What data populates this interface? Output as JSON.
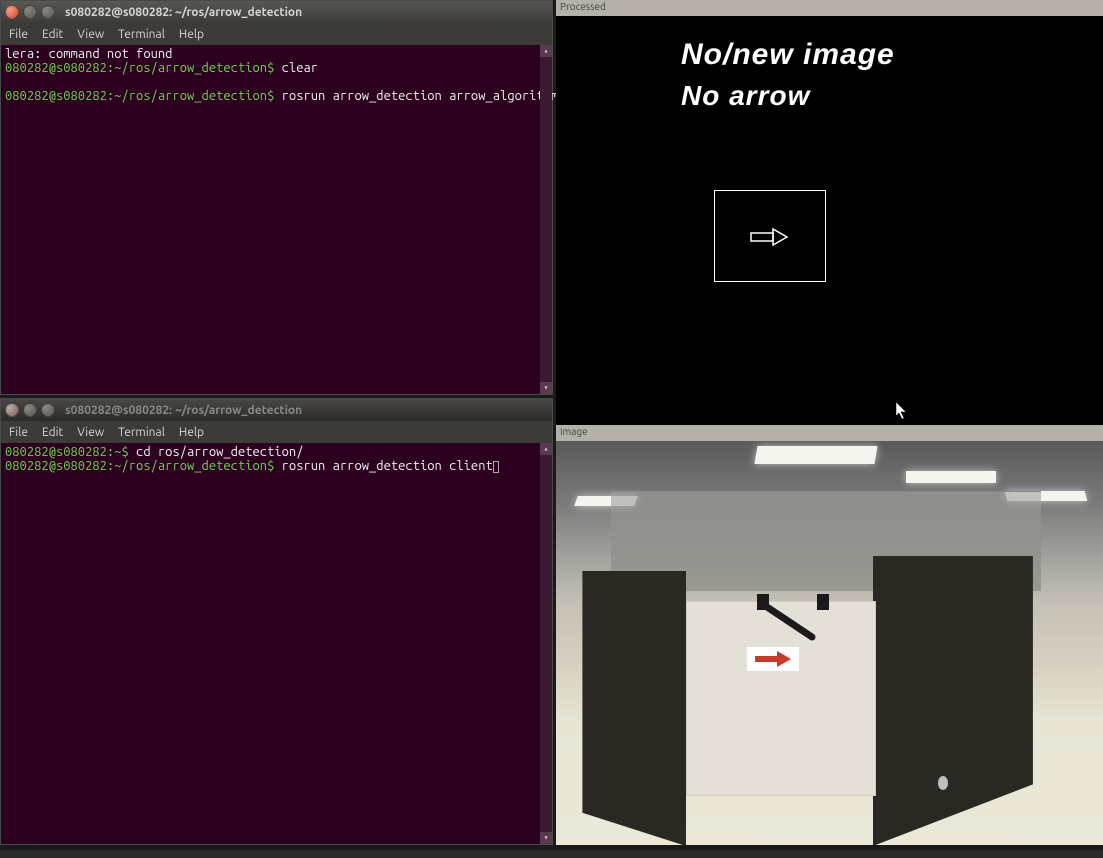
{
  "terminal1": {
    "title": "s080282@s080282: ~/ros/arrow_detection",
    "menu": [
      "File",
      "Edit",
      "View",
      "Terminal",
      "Help"
    ],
    "lines": [
      {
        "type": "output",
        "text": "lera: command not found"
      },
      {
        "type": "prompt",
        "prompt": "080282@s080282:~/ros/arrow_detection$",
        "cmd": " clear"
      },
      {
        "type": "blank",
        "text": ""
      },
      {
        "type": "prompt",
        "prompt": "080282@s080282:~/ros/arrow_detection$",
        "cmd": " rosrun arrow_detection arrow_algorithm ",
        "cursor": "block"
      }
    ]
  },
  "terminal2": {
    "title": "s080282@s080282: ~/ros/arrow_detection",
    "menu": [
      "File",
      "Edit",
      "View",
      "Terminal",
      "Help"
    ],
    "lines": [
      {
        "type": "prompt",
        "prompt": "080282@s080282:~$",
        "cmd": " cd ros/arrow_detection/"
      },
      {
        "type": "prompt",
        "prompt": "080282@s080282:~/ros/arrow_detection$",
        "cmd": " rosrun arrow_detection client",
        "cursor": "outline"
      }
    ]
  },
  "detection": {
    "header": "Processed",
    "status_image": "No/new image",
    "status_arrow": "No arrow"
  },
  "camera": {
    "header": "Image"
  }
}
